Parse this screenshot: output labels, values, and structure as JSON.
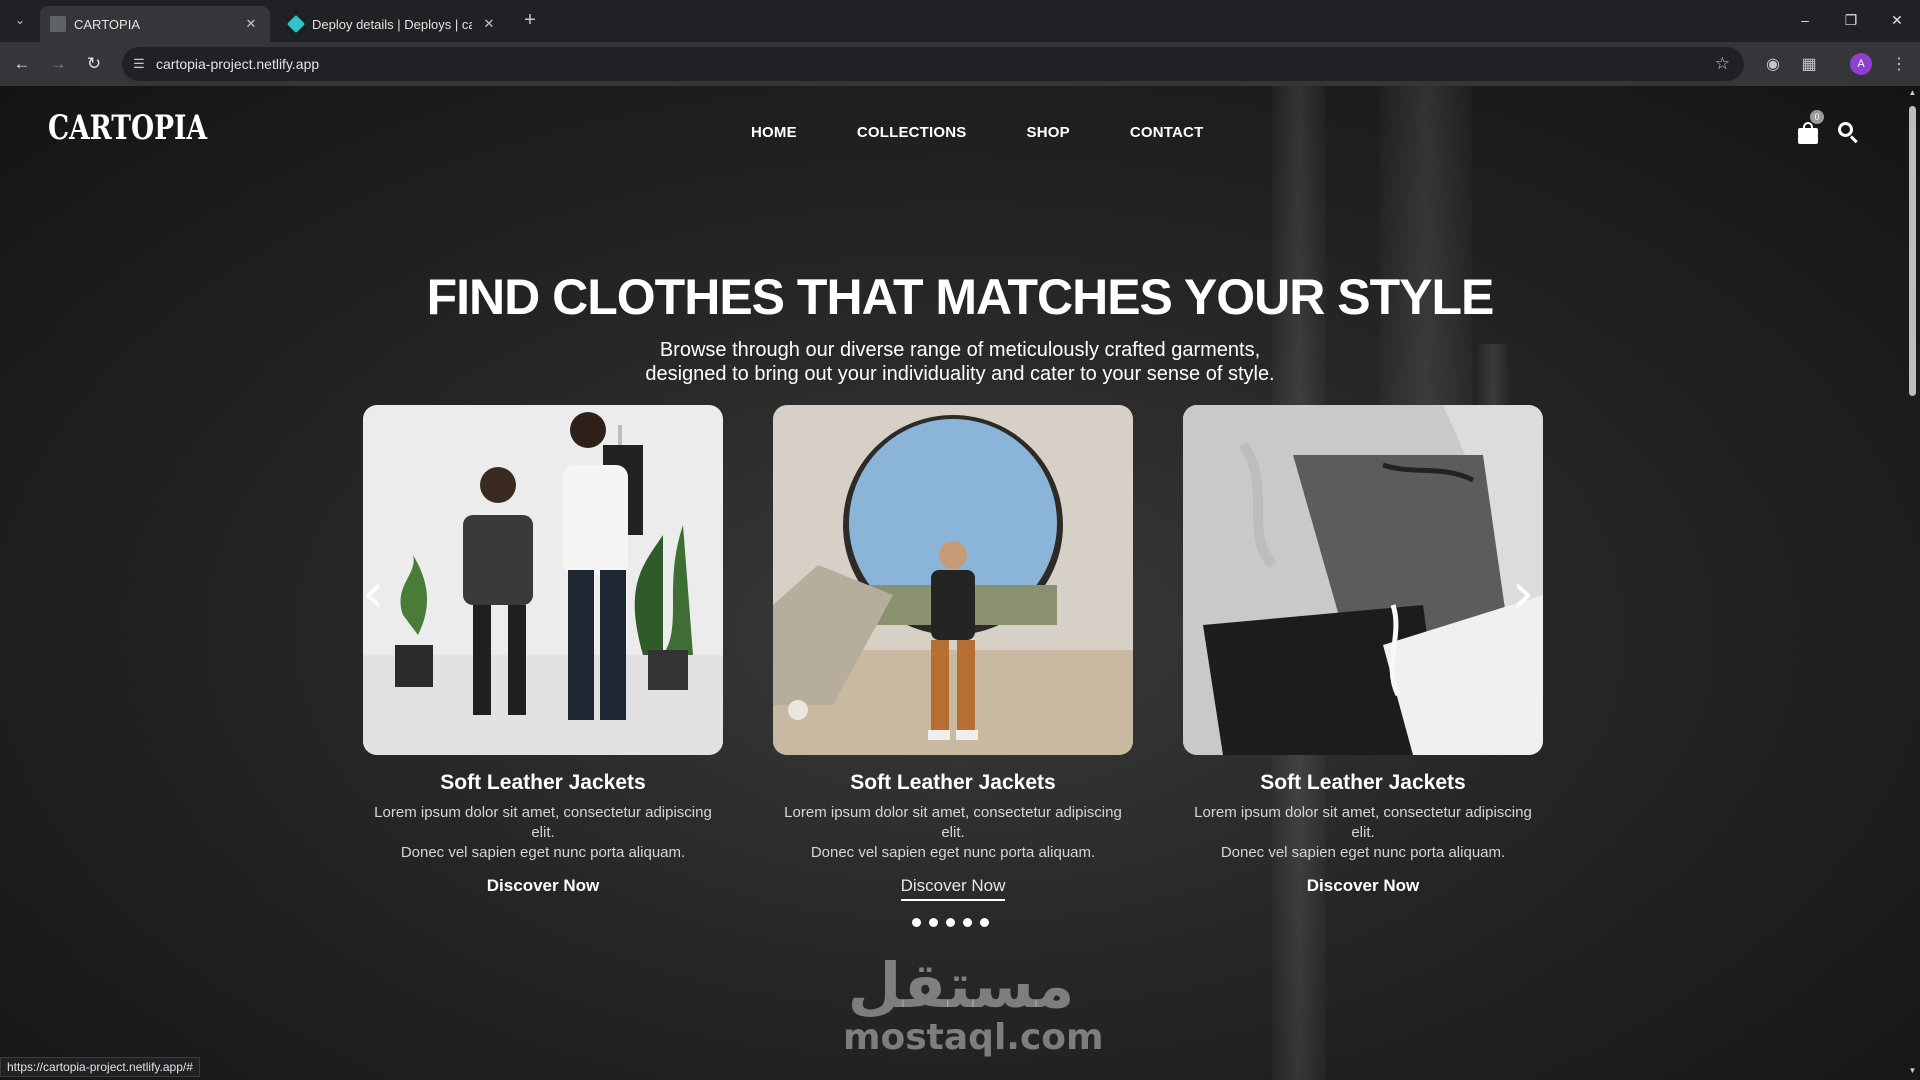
{
  "browser": {
    "tabs": [
      {
        "title": "CARTOPIA",
        "active": true
      },
      {
        "title": "Deploy details | Deploys | carto",
        "active": false
      }
    ],
    "url": "cartopia-project.netlify.app",
    "profile_initial": "A",
    "status_url": "https://cartopia-project.netlify.app/#"
  },
  "site": {
    "logo": "CARTOPIA",
    "nav": [
      "HOME",
      "COLLECTIONS",
      "SHOP",
      "CONTACT"
    ],
    "cart_count": "0",
    "hero": {
      "title": "FIND CLOTHES THAT MATCHES YOUR STYLE",
      "subtitle_line1": "Browse through our diverse range of meticulously crafted garments,",
      "subtitle_line2": "designed to bring out your individuality and cater to your sense of style."
    },
    "cards": [
      {
        "name": "Soft Leather Jackets",
        "desc1": "Lorem ipsum dolor sit amet, consectetur adipiscing elit.",
        "desc2": "Donec vel sapien eget nunc porta aliquam.",
        "cta": "Discover Now"
      },
      {
        "name": "Soft Leather Jackets",
        "desc1": "Lorem ipsum dolor sit amet, consectetur adipiscing elit.",
        "desc2": "Donec vel sapien eget nunc porta aliquam.",
        "cta": "Discover Now"
      },
      {
        "name": "Soft Leather Jackets",
        "desc1": "Lorem ipsum dolor sit amet, consectetur adipiscing elit.",
        "desc2": "Donec vel sapien eget nunc porta aliquam.",
        "cta": "Discover Now"
      }
    ],
    "slider_dots": 5,
    "watermark": {
      "arabic": "مستقل",
      "latin": "mostaql.com"
    }
  }
}
